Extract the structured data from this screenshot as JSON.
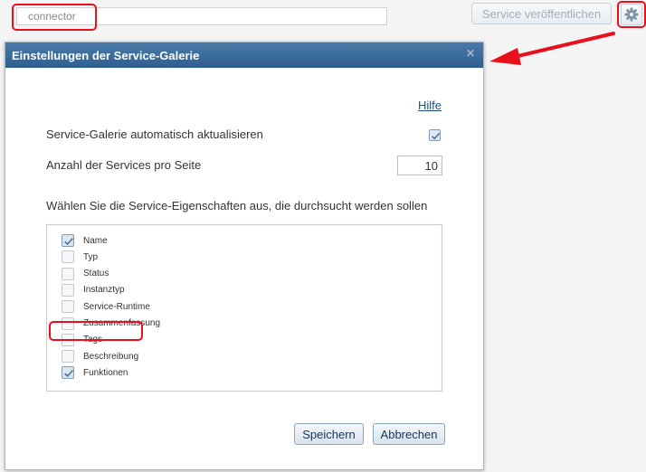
{
  "topbar": {
    "search_placeholder": "connector",
    "publish_label": "Service veröffentlichen"
  },
  "dialog": {
    "title": "Einstellungen der Service-Galerie",
    "help_label": "Hilfe",
    "auto_update_label": "Service-Galerie automatisch aktualisieren",
    "auto_update_checked": true,
    "per_page_label": "Anzahl der Services pro Seite",
    "per_page_value": "10",
    "properties_label": "Wählen Sie die Service-Eigenschaften aus, die durchsucht werden sollen",
    "properties": [
      {
        "label": "Name",
        "checked": true
      },
      {
        "label": "Typ",
        "checked": false
      },
      {
        "label": "Status",
        "checked": false
      },
      {
        "label": "Instanztyp",
        "checked": false
      },
      {
        "label": "Service-Runtime",
        "checked": false
      },
      {
        "label": "Zusammenfassung",
        "checked": false
      },
      {
        "label": "Tags",
        "checked": false
      },
      {
        "label": "Beschreibung",
        "checked": false
      },
      {
        "label": "Funktionen",
        "checked": true
      }
    ],
    "save_label": "Speichern",
    "cancel_label": "Abbrechen"
  },
  "colors": {
    "header": "#3a6a99",
    "highlight": "#e8101a"
  },
  "icons": {
    "settings": "gear-icon",
    "close": "close-icon",
    "checkbox": "checkmark-icon"
  }
}
